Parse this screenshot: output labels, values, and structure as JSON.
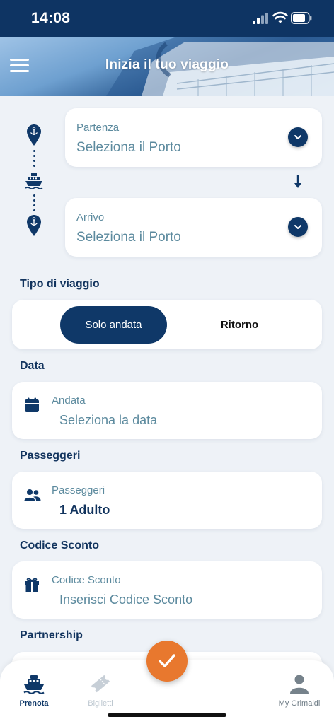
{
  "status_bar": {
    "time": "14:08"
  },
  "header": {
    "title": "Inizia il tuo viaggio"
  },
  "route": {
    "departure": {
      "label": "Partenza",
      "value": "Seleziona il Porto"
    },
    "arrival": {
      "label": "Arrivo",
      "value": "Seleziona il Porto"
    }
  },
  "trip_type": {
    "title": "Tipo di viaggio",
    "options": [
      "Solo andata",
      "Ritorno"
    ],
    "selected": "Solo andata"
  },
  "date": {
    "title": "Data",
    "label": "Andata",
    "value": "Seleziona la data"
  },
  "passengers": {
    "title": "Passeggeri",
    "label": "Passeggeri",
    "value": "1 Adulto"
  },
  "discount": {
    "title": "Codice Sconto",
    "label": "Codice Sconto",
    "value": "Inserisci Codice Sconto"
  },
  "partnership": {
    "title": "Partnership"
  },
  "bottom_nav": {
    "items": [
      {
        "label": "Prenota",
        "icon": "ship-icon",
        "active": true
      },
      {
        "label": "Biglietti",
        "icon": "ticket-icon",
        "active": false
      },
      {
        "label": "My Grimaldi",
        "icon": "user-icon",
        "active": false
      }
    ]
  },
  "colors": {
    "primary": "#0f3868",
    "accent": "#e8782e",
    "muted_text": "#5c8a9e",
    "background": "#eef2f7"
  }
}
